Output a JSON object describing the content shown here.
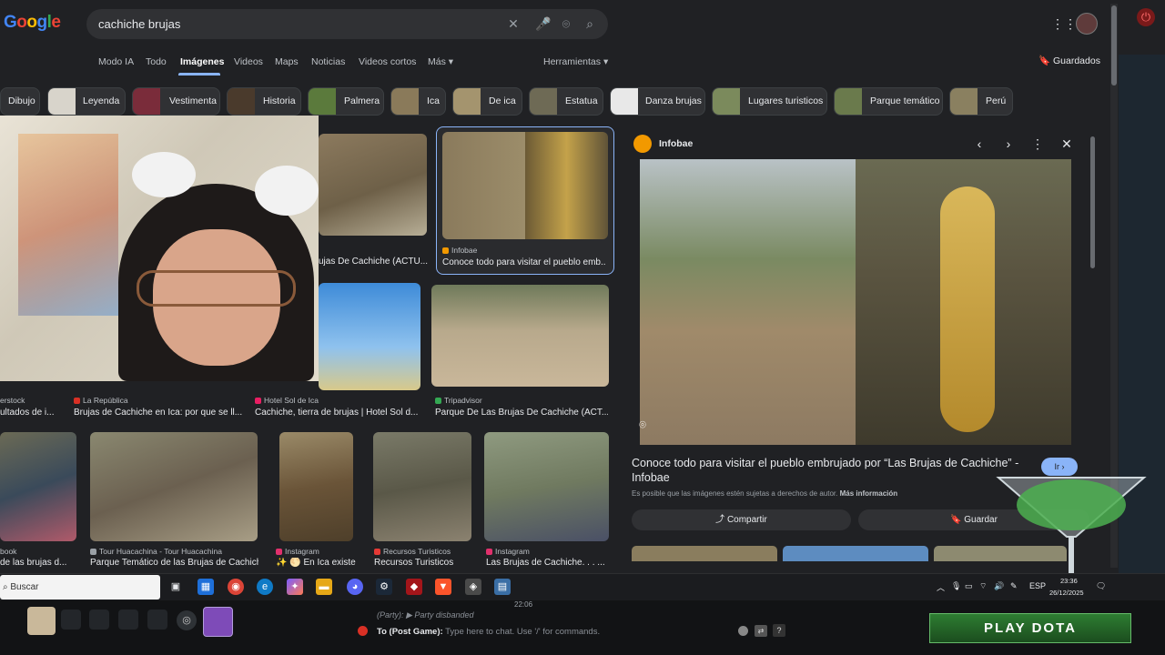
{
  "header": {
    "logo": "Google",
    "search_query": "cachiche brujas"
  },
  "tabs": [
    {
      "label": "Modo IA"
    },
    {
      "label": "Todo"
    },
    {
      "label": "Imágenes"
    },
    {
      "label": "Videos"
    },
    {
      "label": "Maps"
    },
    {
      "label": "Noticias"
    },
    {
      "label": "Videos cortos"
    },
    {
      "label": "Más"
    }
  ],
  "tools": {
    "herramientas": "Herramientas",
    "guardados": "Guardados"
  },
  "chips": [
    {
      "label": "Dibujo"
    },
    {
      "label": "Leyenda"
    },
    {
      "label": "Vestimenta"
    },
    {
      "label": "Historia"
    },
    {
      "label": "Palmera"
    },
    {
      "label": "Ica"
    },
    {
      "label": "De ica"
    },
    {
      "label": "Estatua"
    },
    {
      "label": "Danza brujas"
    },
    {
      "label": "Lugares turisticos"
    },
    {
      "label": "Parque temático"
    },
    {
      "label": "Perú"
    }
  ],
  "results": {
    "r1_1": {
      "title": "ujas De Cachiche (ACTU..."
    },
    "r1_2": {
      "source": "Infobae",
      "title": "Conoce todo para visitar el pueblo emb..."
    },
    "r2_0": {
      "source": "erstock",
      "title": "ultados de i..."
    },
    "r2_1": {
      "source": "La República",
      "title": "Brujas de Cachiche en Ica: por que se ll..."
    },
    "r2_2": {
      "source": "Hotel Sol de Ica",
      "title": "Cachiche, tierra de brujas | Hotel Sol d..."
    },
    "r2_3": {
      "source": "Tripadvisor",
      "title": "Parque De Las Brujas De Cachiche (ACT..."
    },
    "r3_0": {
      "source": "book",
      "title": "de las brujas d..."
    },
    "r3_1": {
      "source": "Tour Huacachina - Tour Huacachina",
      "title": "Parque Temático de las Brujas de Cachiche..."
    },
    "r3_2": {
      "source": "Instagram",
      "title": "✨ 🌕 En Ica existe ..."
    },
    "r3_3": {
      "source": "Recursos Turisticos",
      "title": "Recursos Turisticos"
    },
    "r3_4": {
      "source": "Instagram",
      "title": "Las Brujas de Cachiche. . . ..."
    }
  },
  "panel": {
    "source": "Infobae",
    "title": "Conoce todo para visitar el pueblo embrujado por “Las Brujas de Cachiche” - Infobae",
    "notice": "Es posible que las imágenes estén sujetas a derechos de autor.",
    "notice_link": "Más información",
    "ir_button": "Ir",
    "share_button": "Compartir",
    "save_button": "Guardar"
  },
  "taskbar": {
    "search_label": "Buscar",
    "tray_lang": "ESP",
    "time": "23:36",
    "date": "26/12/2025"
  },
  "overlay": {
    "chat_status": "(Party): ▶ Party disbanded",
    "chat_target": "To (Post Game):",
    "chat_placeholder": "Type here to chat. Use '/' for commands.",
    "clock": "22:06",
    "play_button": "PLAY DOTA"
  },
  "colors": {
    "accent_blue": "#8ab4f8",
    "background": "#202124",
    "surface": "#303134"
  }
}
